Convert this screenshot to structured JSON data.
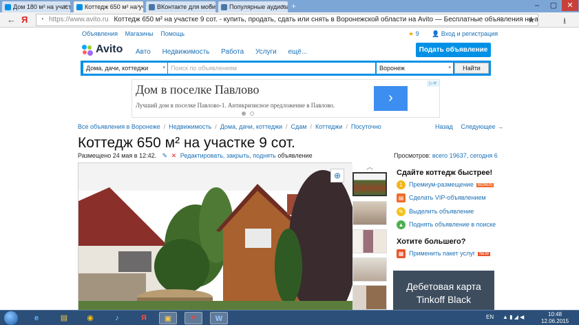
{
  "browser": {
    "tabs": [
      {
        "title": "Дом 180 м² на участк",
        "active": false,
        "icon_color": "#0091e6"
      },
      {
        "title": "Коттедж 650 м² на участ",
        "active": true,
        "icon_color": "#0091e6"
      },
      {
        "title": "ВКонтакте для мобил",
        "active": false,
        "icon_color": "#4a76a8"
      },
      {
        "title": "Популярные аудиоза",
        "active": false,
        "icon_color": "#4a76a8"
      }
    ],
    "new_tab": "+",
    "window_controls": {
      "minimize": "–",
      "maximize": "▢",
      "close": "✕"
    },
    "nav": {
      "back": "←",
      "yandex": "Я",
      "lock": "🔒"
    },
    "url_host": "https://www.avito.ru",
    "url_title": "Коттедж 650 м² на участке 9 сот. - купить, продать, сдать или снять в Воронежской области на Avito — Бесплатные объявления на а...",
    "star": "★",
    "download": "⭳"
  },
  "avito": {
    "top_links": [
      "Объявления",
      "Магазины",
      "Помощь"
    ],
    "favorites": {
      "icon": "★",
      "count": "9"
    },
    "login": "Вход и регистрация",
    "logo": "Avito",
    "nav": [
      "Авто",
      "Недвижимость",
      "Работа",
      "Услуги",
      "ещё..."
    ],
    "submit_button": "Подать объявление",
    "search": {
      "category": "Дома, дачи, коттеджи",
      "placeholder": "Поиск по объявлениям",
      "city": "Воронеж",
      "button": "Найти",
      "dropdown_icon": "▾"
    },
    "ad": {
      "title": "Дом в поселке Павлово",
      "text": "Лучший дом в поселке Павлово-1. Антикризисное предложение в Павлово.",
      "arrow": "›",
      "choice": "▷✕"
    },
    "breadcrumbs": [
      "Все объявления в Воронеже",
      "Недвижимость",
      "Дома, дачи, коттеджи",
      "Сдам",
      "Коттеджи",
      "Посуточно"
    ],
    "breadcrumb_sep": "/",
    "back": "Назад",
    "next": "Следующее →",
    "listing": {
      "title": "Коттедж 650 м² на участке 9 сот.",
      "posted": "Размещено 24 мая в 12:42.",
      "edit_icon": "✎",
      "delete_icon": "✕",
      "actions": "Редактировать, закрыть, поднять",
      "actions_suffix": "объявление",
      "views_label": "Просмотров:",
      "views_value": "всего 19637, сегодня 6",
      "zoom_icon": "⊕",
      "thumbs_up": "︿"
    },
    "sidebar": {
      "sell_heading": "Сдайте коттедж быстрее!",
      "items": [
        {
          "label": "Премиум-размещение",
          "badge": "BONUS",
          "icon": "1",
          "color": "#f2b51c"
        },
        {
          "label": "Сделать VIP-объявлением",
          "icon": "▤",
          "color": "#f06a2a"
        },
        {
          "label": "Выделить объявление",
          "icon": "✎",
          "color": "#f4c21c"
        },
        {
          "label": "Поднять объявление в поиске",
          "icon": "▲",
          "color": "#4caf50"
        }
      ],
      "more_heading": "Хотите большего?",
      "package": {
        "label": "Применить пакет услуг",
        "badge": "NEW",
        "icon": "▦",
        "color": "#e8552b"
      },
      "banner": [
        "Дебетовая карта",
        "Tinkoff Black"
      ]
    }
  },
  "taskbar": {
    "icons": [
      "e",
      "▤",
      "◉",
      "♪",
      "Я",
      "▣",
      "Y",
      "W"
    ],
    "lang": "EN",
    "tray": "▲ ▮ ◢ ◀",
    "time": "10:48",
    "date": "12.06.2015"
  }
}
